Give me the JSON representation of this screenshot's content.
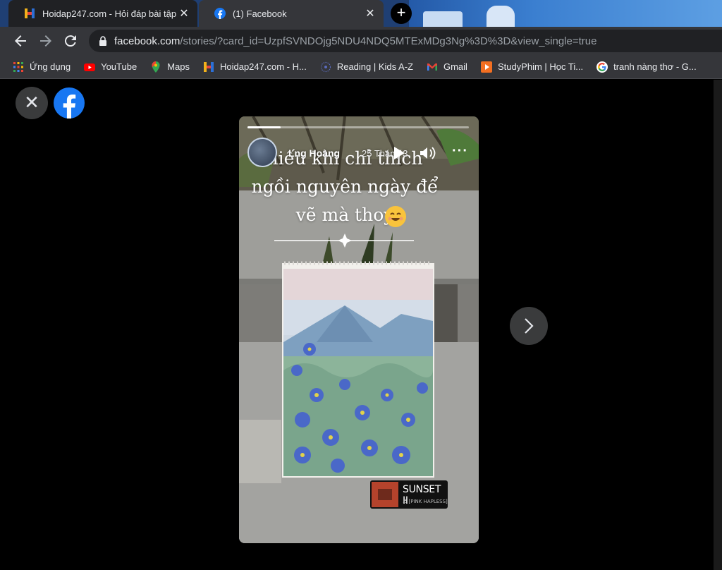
{
  "tabs": [
    {
      "title": "Hoidap247.com - Hỏi đáp bài tập",
      "favicon": "hoidap247-icon",
      "active": false
    },
    {
      "title": "(1) Facebook",
      "favicon": "facebook-icon",
      "active": true
    }
  ],
  "toolbar": {
    "url_host": "facebook.com",
    "url_path": "/stories/?card_id=UzpfSVNDOjg5NDU4NDQ5MTExMDg3Ng%3D%3D&view_single=true"
  },
  "bookmarks": [
    {
      "label": "Ứng dụng",
      "icon": "apps-grid-icon"
    },
    {
      "label": "YouTube",
      "icon": "youtube-icon"
    },
    {
      "label": "Maps",
      "icon": "maps-pin-icon"
    },
    {
      "label": "Hoidap247.com - H...",
      "icon": "hoidap247-icon"
    },
    {
      "label": "Reading | Kids A-Z",
      "icon": "reading-icon"
    },
    {
      "label": "Gmail",
      "icon": "gmail-icon"
    },
    {
      "label": "StudyPhim | Học Ti...",
      "icon": "studyphim-icon"
    },
    {
      "label": "tranh nàng thơ - G...",
      "icon": "google-icon"
    }
  ],
  "story": {
    "author": "Lng Hoàng",
    "time": "25 Tháng 3",
    "progress": 0.15,
    "caption": [
      "hiếu khi chỉ thích",
      "ngồi nguyên ngày để",
      "vẽ mà thoy"
    ],
    "music": {
      "song": "SUNSET II",
      "artist": "♬ [PINK HAPLESS]"
    }
  },
  "colors": {
    "facebook_blue": "#1877f2",
    "tab_active": "#35363a",
    "toolbar": "#35363a",
    "control_bg": "#3a3b3c"
  }
}
